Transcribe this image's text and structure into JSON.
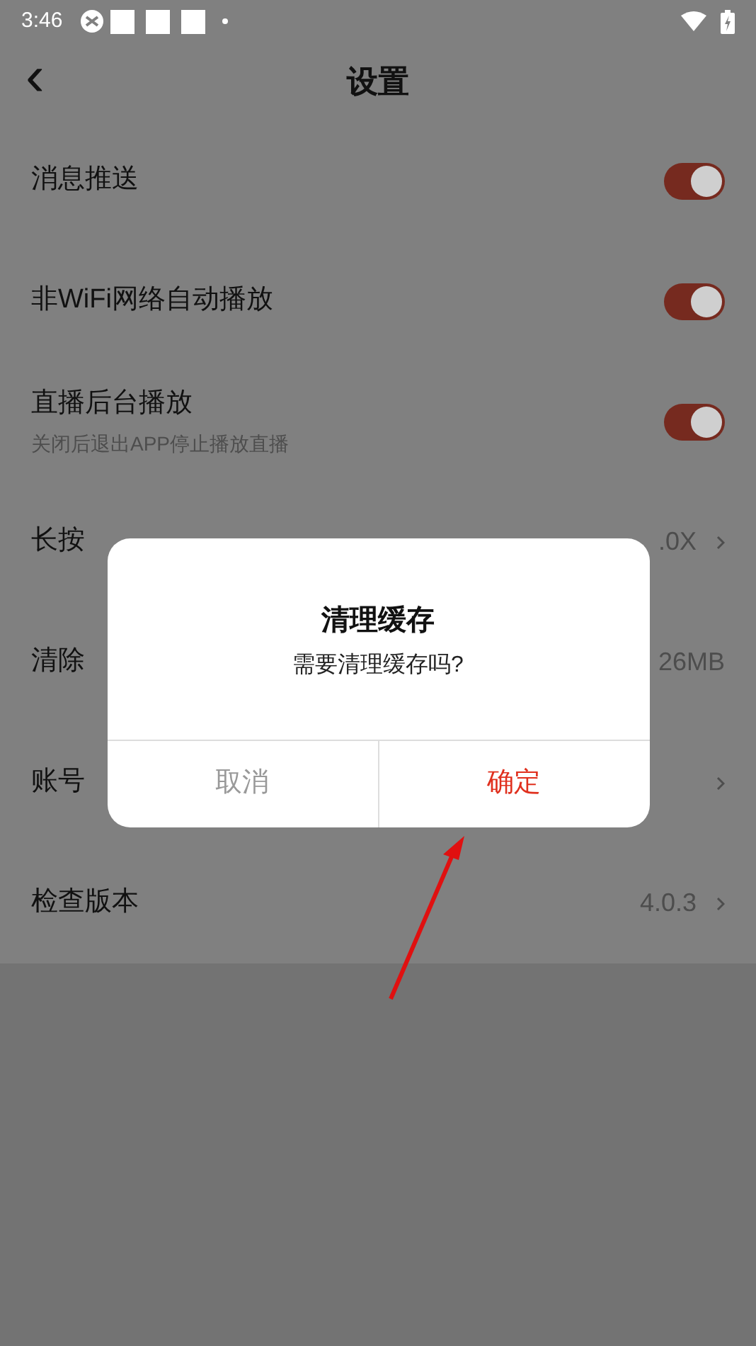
{
  "status_bar": {
    "time": "3:46"
  },
  "header": {
    "back": "‹",
    "title": "设置"
  },
  "settings": [
    {
      "kind": "toggle",
      "label": "消息推送",
      "on": true
    },
    {
      "kind": "toggle",
      "label": "非WiFi网络自动播放",
      "on": true
    },
    {
      "kind": "toggle",
      "label": "直播后台播放",
      "subtitle": "关闭后退出APP停止播放直播",
      "on": true
    },
    {
      "kind": "link",
      "label": "长按",
      "value": ".0X"
    },
    {
      "kind": "value",
      "label": "清除",
      "value": "26MB"
    },
    {
      "kind": "link",
      "label": "账号"
    },
    {
      "kind": "link",
      "label": "检查版本",
      "value": "4.0.3"
    }
  ],
  "dialog": {
    "title": "清理缓存",
    "message": "需要清理缓存吗?",
    "buttons": [
      {
        "label": "取消",
        "kind": "cancel"
      },
      {
        "label": "确定",
        "kind": "confirm"
      }
    ]
  }
}
